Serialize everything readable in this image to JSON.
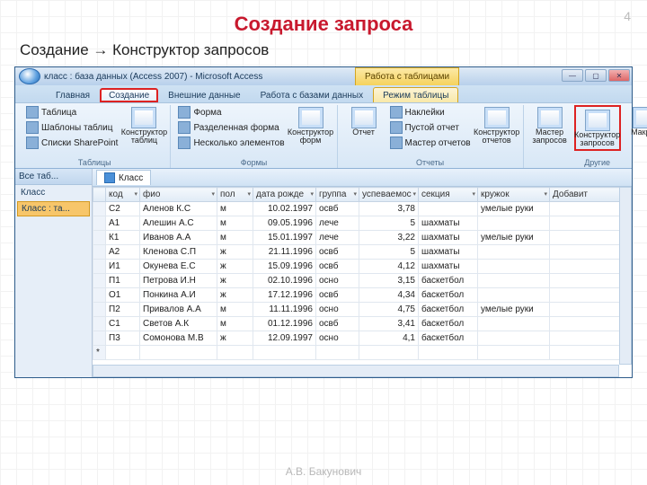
{
  "slide": {
    "number": "4",
    "title": "Создание запроса",
    "subtitle": "Создание → Конструктор запросов",
    "footer": "А.В. Бакунович"
  },
  "window": {
    "title": "класс : база данных (Access 2007) - Microsoft Access",
    "context_tab": "Работа с таблицами",
    "tabs": [
      "Главная",
      "Создание",
      "Внешние данные",
      "Работа с базами данных",
      "Режим таблицы"
    ]
  },
  "ribbon": {
    "groups": {
      "tables": {
        "label": "Таблицы",
        "items": [
          "Таблица",
          "Шаблоны таблиц",
          "Списки SharePoint"
        ],
        "big": "Конструктор таблиц"
      },
      "forms": {
        "label": "Формы",
        "items": [
          "Форма",
          "Разделенная форма",
          "Несколько элементов"
        ],
        "big": "Конструктор форм"
      },
      "reports": {
        "label": "Отчеты",
        "big1": "Отчет",
        "items": [
          "Наклейки",
          "Пустой отчет",
          "Мастер отчетов"
        ],
        "big2": "Конструктор отчетов"
      },
      "other": {
        "label": "Другие",
        "big1": "Мастер запросов",
        "big2": "Конструктор запросов",
        "big3": "Макрос"
      }
    }
  },
  "nav": {
    "header": "Все таб...",
    "cat": "Класс",
    "item": "Класс : та..."
  },
  "sheet": {
    "tab": "Класс"
  },
  "columns": [
    "код",
    "фио",
    "пол",
    "дата рожде",
    "группа",
    "успеваемос",
    "секция",
    "кружок",
    "Добавит"
  ],
  "rows": [
    {
      "code": "С2",
      "fio": "Аленов К.С",
      "sex": "м",
      "dob": "10.02.1997",
      "grp": "освб",
      "perf": "3,78",
      "sec": "",
      "club": "умелые руки"
    },
    {
      "code": "А1",
      "fio": "Алешин А.С",
      "sex": "м",
      "dob": "09.05.1996",
      "grp": "лече",
      "perf": "5",
      "sec": "шахматы",
      "club": ""
    },
    {
      "code": "К1",
      "fio": "Иванов А.А",
      "sex": "м",
      "dob": "15.01.1997",
      "grp": "лече",
      "perf": "3,22",
      "sec": "шахматы",
      "club": "умелые руки"
    },
    {
      "code": "А2",
      "fio": "Кленова С.П",
      "sex": "ж",
      "dob": "21.11.1996",
      "grp": "освб",
      "perf": "5",
      "sec": "шахматы",
      "club": ""
    },
    {
      "code": "И1",
      "fio": "Окунева Е.С",
      "sex": "ж",
      "dob": "15.09.1996",
      "grp": "освб",
      "perf": "4,12",
      "sec": "шахматы",
      "club": ""
    },
    {
      "code": "П1",
      "fio": "Петрова И.Н",
      "sex": "ж",
      "dob": "02.10.1996",
      "grp": "осно",
      "perf": "3,15",
      "sec": "баскетбол",
      "club": ""
    },
    {
      "code": "О1",
      "fio": "Понкина А.И",
      "sex": "ж",
      "dob": "17.12.1996",
      "grp": "освб",
      "perf": "4,34",
      "sec": "баскетбол",
      "club": ""
    },
    {
      "code": "П2",
      "fio": "Привалов А.А",
      "sex": "м",
      "dob": "11.11.1996",
      "grp": "осно",
      "perf": "4,75",
      "sec": "баскетбол",
      "club": "умелые руки"
    },
    {
      "code": "С1",
      "fio": "Светов А.К",
      "sex": "м",
      "dob": "01.12.1996",
      "grp": "освб",
      "perf": "3,41",
      "sec": "баскетбол",
      "club": ""
    },
    {
      "code": "П3",
      "fio": "Сомонова М.В",
      "sex": "ж",
      "dob": "12.09.1997",
      "grp": "осно",
      "perf": "4,1",
      "sec": "баскетбол",
      "club": ""
    }
  ]
}
